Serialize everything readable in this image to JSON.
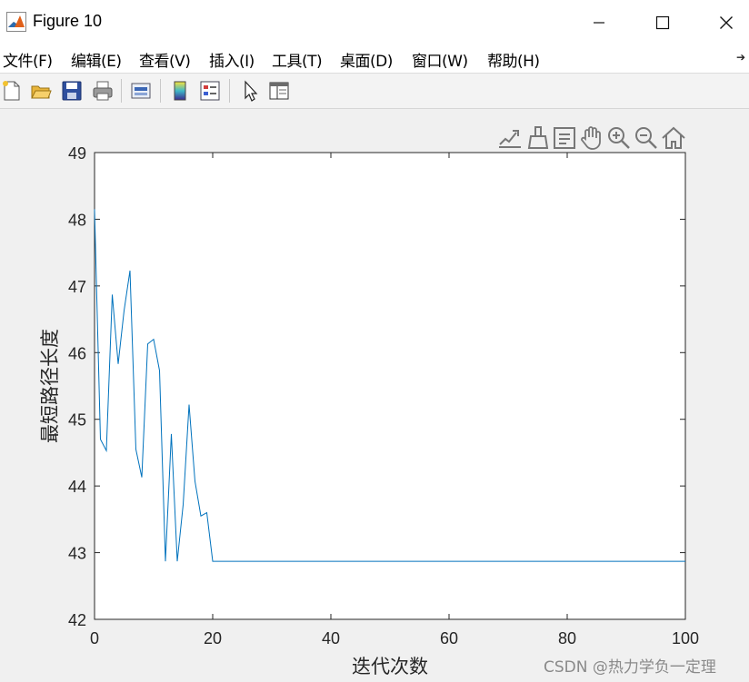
{
  "window": {
    "title": "Figure 10",
    "minimize_glyph": "—",
    "maximize_glyph": "☐",
    "close_glyph": "✕"
  },
  "menubar": {
    "items": [
      {
        "label": "文件(F)"
      },
      {
        "label": "编辑(E)"
      },
      {
        "label": "查看(V)"
      },
      {
        "label": "插入(I)"
      },
      {
        "label": "工具(T)"
      },
      {
        "label": "桌面(D)"
      },
      {
        "label": "窗口(W)"
      },
      {
        "label": "帮助(H)"
      }
    ],
    "pin_glyph": "➔"
  },
  "toolbar": {
    "icons": [
      "new-figure-icon",
      "open-file-icon",
      "save-icon",
      "print-icon",
      "link-plot-icon",
      "insert-colorbar-icon",
      "insert-legend-icon",
      "edit-plot-icon",
      "property-inspector-icon"
    ]
  },
  "axes_toolbar": {
    "icons": [
      "export-icon",
      "brush-icon",
      "data-tips-icon",
      "pan-icon",
      "zoom-in-icon",
      "zoom-out-icon",
      "home-icon"
    ]
  },
  "chart_data": {
    "type": "line",
    "xlabel": "迭代次数",
    "ylabel": "最短路径长度",
    "xlim": [
      0,
      100
    ],
    "ylim": [
      42,
      49
    ],
    "xticks": [
      0,
      20,
      40,
      60,
      80,
      100
    ],
    "yticks": [
      42,
      43,
      44,
      45,
      46,
      47,
      48,
      49
    ],
    "grid": false,
    "line_color": "#0072bd",
    "series": [
      {
        "x": [
          0,
          1,
          2,
          3,
          4,
          5,
          6,
          7,
          8,
          9,
          10,
          11,
          12,
          13,
          14,
          15,
          16,
          17,
          18,
          19,
          20,
          21,
          100
        ],
        "y": [
          48.15,
          44.7,
          44.53,
          46.87,
          45.83,
          46.63,
          47.23,
          44.55,
          44.13,
          46.13,
          46.2,
          45.73,
          42.87,
          44.78,
          42.87,
          43.72,
          45.22,
          44.07,
          43.55,
          43.6,
          42.87,
          42.87,
          42.87
        ]
      }
    ]
  },
  "watermark": {
    "text": "CSDN @热力学负一定理"
  }
}
